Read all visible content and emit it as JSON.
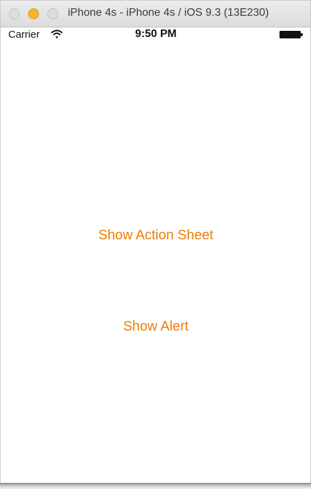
{
  "window": {
    "title": "iPhone 4s - iPhone 4s / iOS 9.3 (13E230)",
    "controls": {
      "close_color": "#dcdcdc",
      "minimize_color": "#f6b52b",
      "zoom_color": "#dcdcdc"
    }
  },
  "status_bar": {
    "carrier": "Carrier",
    "wifi_icon": "wifi-icon",
    "time": "9:50 PM",
    "battery_icon": "battery-icon"
  },
  "main": {
    "action_sheet_button": "Show Action Sheet",
    "alert_button": "Show Alert"
  },
  "colors": {
    "accent": "#f07d00",
    "background": "#ffffff"
  }
}
